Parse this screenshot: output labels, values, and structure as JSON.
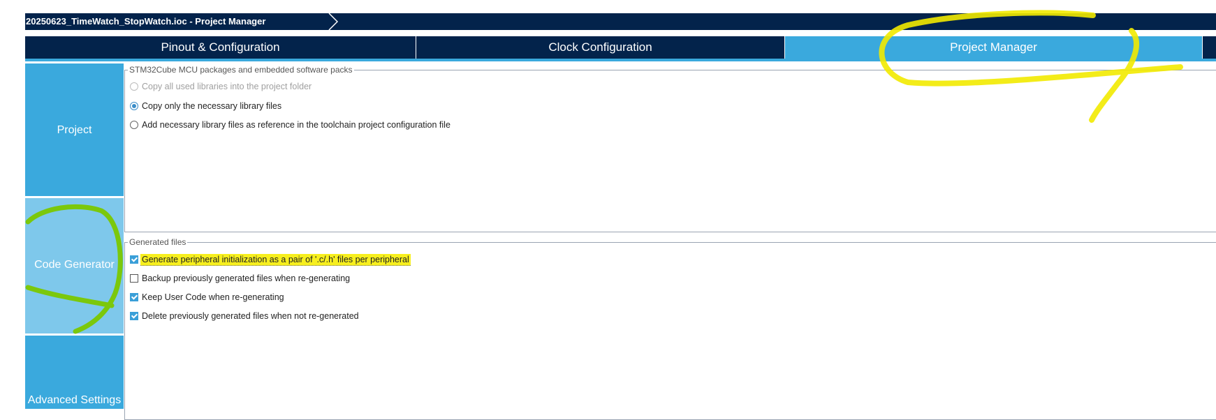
{
  "window": {
    "breadcrumb": "20250623_TimeWatch_StopWatch.ioc - Project Manager"
  },
  "tabs": [
    {
      "label": "Pinout & Configuration"
    },
    {
      "label": "Clock Configuration"
    },
    {
      "label": "Project Manager"
    }
  ],
  "sidebar": {
    "items": [
      {
        "label": "Project"
      },
      {
        "label": "Code Generator"
      },
      {
        "label": "Advanced Settings"
      }
    ]
  },
  "packages": {
    "legend": "STM32Cube MCU packages and embedded software packs",
    "options": [
      {
        "label": "Copy all used libraries into the project folder",
        "selected": false,
        "enabled": false
      },
      {
        "label": "Copy only the necessary library files",
        "selected": true,
        "enabled": true
      },
      {
        "label": "Add necessary library files as reference in the toolchain project configuration file",
        "selected": false,
        "enabled": true
      }
    ]
  },
  "generated_files": {
    "legend": "Generated files",
    "options": [
      {
        "label": "Generate peripheral initialization as a pair of '.c/.h' files per peripheral",
        "checked": true,
        "highlighted": true
      },
      {
        "label": "Backup previously generated files when re-generating",
        "checked": false
      },
      {
        "label": "Keep User Code when re-generating",
        "checked": true
      },
      {
        "label": "Delete previously generated files when not re-generated",
        "checked": true
      }
    ]
  },
  "colors": {
    "navy": "#03234b",
    "tab_active": "#3aa9dd",
    "sidebar_active": "#7ec8eb",
    "annotation_yellow": "#f2ea00",
    "annotation_green": "#7bc800"
  }
}
